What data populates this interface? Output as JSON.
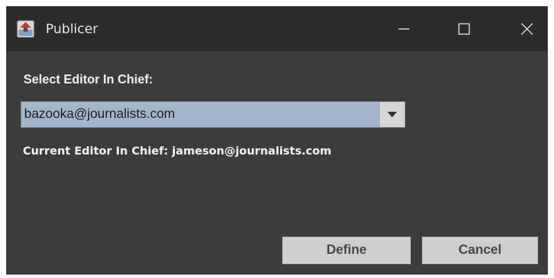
{
  "window": {
    "title": "Publicer",
    "app_icon": "publicer-app-icon",
    "controls": {
      "minimize_icon": "minimize-icon",
      "maximize_icon": "maximize-icon",
      "close_icon": "close-icon"
    }
  },
  "form": {
    "select_label": "Select Editor In Chief:",
    "select": {
      "selected_value": "bazooka@journalists.com",
      "arrow_icon": "chevron-down-icon"
    },
    "current_editor_text": "Current Editor In Chief: jameson@journalists.com"
  },
  "buttons": {
    "define_label": "Define",
    "cancel_label": "Cancel"
  },
  "colors": {
    "titlebar": "#2b2b2b",
    "window_bg": "#3c3c3c",
    "combo_bg": "#a4b6cc",
    "button_bg": "#cfcfcf"
  }
}
